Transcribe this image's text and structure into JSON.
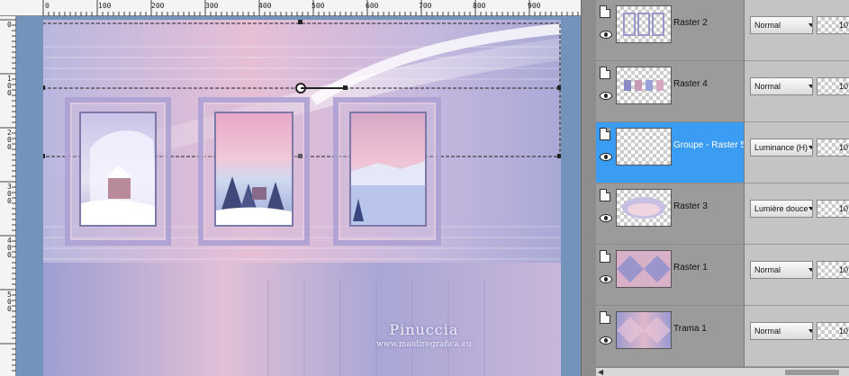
{
  "ruler": {
    "top_labels": [
      "0",
      "100",
      "200",
      "300",
      "400",
      "500",
      "600",
      "700",
      "800",
      "900"
    ],
    "left_labels": [
      "0",
      "100",
      "200",
      "300",
      "400",
      "500"
    ]
  },
  "canvas": {
    "watermark_name": "Pinuccia",
    "watermark_url": "www.maidiregrafica.eu"
  },
  "layers": [
    {
      "name": "Raster 2",
      "blend": "Normal",
      "opacity": "10",
      "selected": false,
      "thumb": "frames-icon"
    },
    {
      "name": "Raster 4",
      "blend": "Normal",
      "opacity": "10",
      "selected": false,
      "thumb": "color-swatches-icon"
    },
    {
      "name": "Groupe - Raster 5",
      "blend": "Luminance (H)",
      "opacity": "10",
      "selected": true,
      "thumb": "empty-layer"
    },
    {
      "name": "Raster 3",
      "blend": "Lumière douce",
      "opacity": "10",
      "selected": false,
      "thumb": "winter-scene-icon"
    },
    {
      "name": "Raster 1",
      "blend": "Normal",
      "opacity": "10",
      "selected": false,
      "thumb": "pattern-icon"
    },
    {
      "name": "Trama 1",
      "blend": "Normal",
      "opacity": "10",
      "selected": false,
      "thumb": "gradient-icon"
    }
  ],
  "colors": {
    "selected_row": "#3b9cf4",
    "panel_bg": "#9b9b9b",
    "canvas_pink": "#e6bfd6",
    "canvas_lavender": "#a9a9d6"
  }
}
